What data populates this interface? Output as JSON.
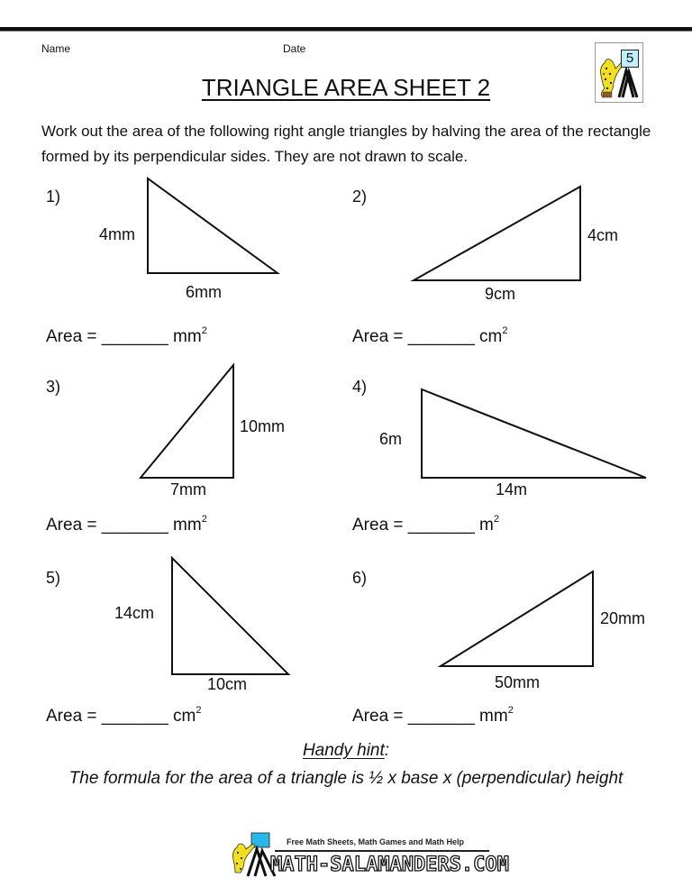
{
  "header": {
    "name_label": "Name",
    "date_label": "Date",
    "title": "TRIANGLE AREA SHEET 2",
    "grade_badge": "5"
  },
  "instructions": "Work out the area of the following right angle triangles by halving the area of the rectangle formed by its perpendicular sides. They are not drawn to scale.",
  "questions": [
    {
      "number": "1)",
      "height_label": "4mm",
      "base_label": "6mm",
      "area_prefix": "Area = _______",
      "unit": "mm",
      "power": "2"
    },
    {
      "number": "2)",
      "height_label": "4cm",
      "base_label": "9cm",
      "area_prefix": "Area = _______",
      "unit": "cm",
      "power": "2"
    },
    {
      "number": "3)",
      "height_label": "10mm",
      "base_label": "7mm",
      "area_prefix": "Area = _______",
      "unit": "mm",
      "power": "2"
    },
    {
      "number": "4)",
      "height_label": "6m",
      "base_label": "14m",
      "area_prefix": "Area = _______",
      "unit": "m",
      "power": "2"
    },
    {
      "number": "5)",
      "height_label": "14cm",
      "base_label": "10cm",
      "area_prefix": "Area = _______",
      "unit": "cm",
      "power": "2"
    },
    {
      "number": "6)",
      "height_label": "20mm",
      "base_label": "50mm",
      "area_prefix": "Area = _______",
      "unit": "mm",
      "power": "2"
    }
  ],
  "hint": {
    "title": "Handy hint",
    "colon": ":",
    "text": "The formula for the area of a triangle is ½ x base x (perpendicular) height"
  },
  "footer": {
    "tagline": "Free Math Sheets, Math Games and Math Help",
    "site": "MATH-SALAMANDERS.COM"
  }
}
